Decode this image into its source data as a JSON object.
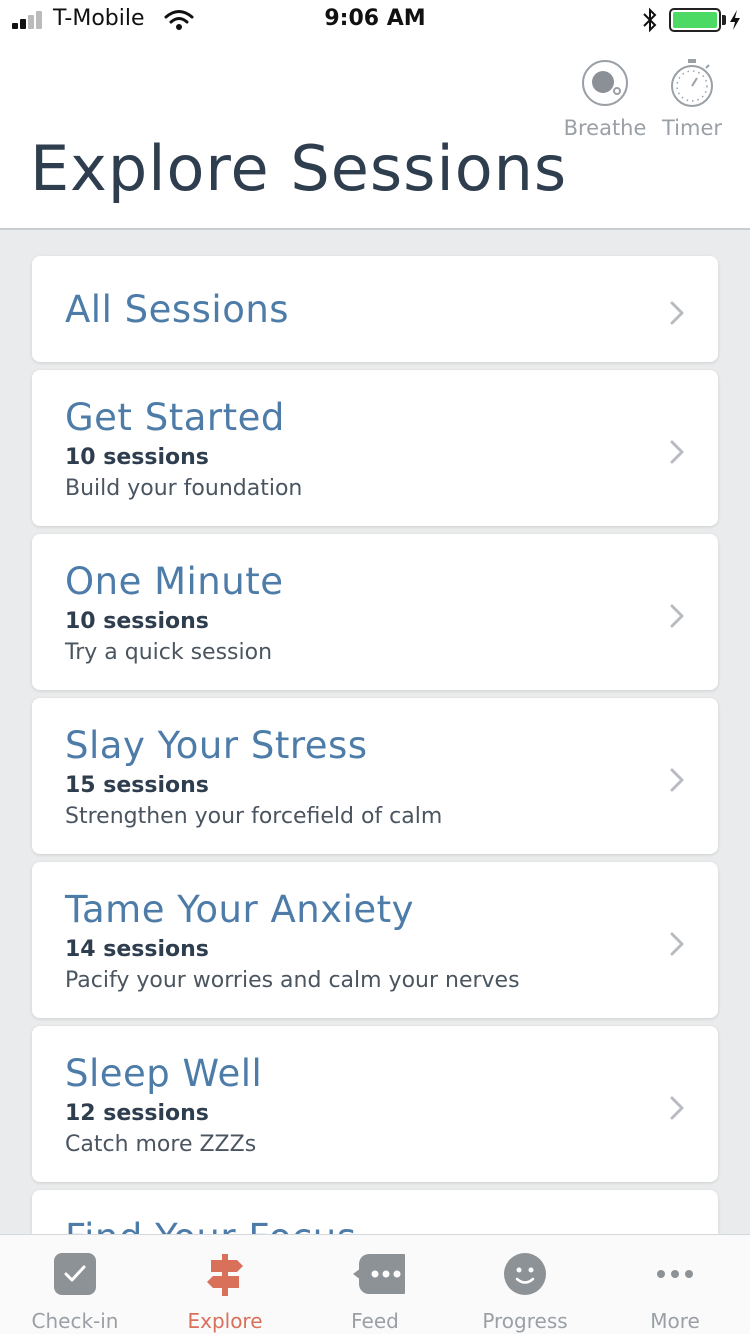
{
  "status_bar": {
    "carrier": "T-Mobile",
    "time": "9:06 AM",
    "icons": [
      "signal-icon",
      "wifi-icon",
      "bluetooth-icon",
      "battery-icon",
      "charging-icon"
    ]
  },
  "header": {
    "title": "Explore Sessions",
    "tools": [
      {
        "label": "Breathe",
        "icon": "breathe-icon"
      },
      {
        "label": "Timer",
        "icon": "stopwatch-icon"
      }
    ]
  },
  "sessions": [
    {
      "title": "All Sessions"
    },
    {
      "title": "Get Started",
      "count": "10 sessions",
      "description": "Build your foundation"
    },
    {
      "title": "One Minute",
      "count": "10 sessions",
      "description": "Try a quick session"
    },
    {
      "title": "Slay Your Stress",
      "count": "15 sessions",
      "description": "Strengthen your forcefield of calm"
    },
    {
      "title": "Tame Your Anxiety",
      "count": "14 sessions",
      "description": "Pacify your worries and calm your nerves"
    },
    {
      "title": "Sleep Well",
      "count": "12 sessions",
      "description": "Catch more ZZZs"
    },
    {
      "title": "Find Your Focus"
    }
  ],
  "tabbar": {
    "tabs": [
      {
        "label": "Check-in",
        "icon": "checkmark-icon"
      },
      {
        "label": "Explore",
        "icon": "signpost-icon",
        "active": true
      },
      {
        "label": "Feed",
        "icon": "chat-bubble-icon"
      },
      {
        "label": "Progress",
        "icon": "smiley-icon"
      },
      {
        "label": "More",
        "icon": "more-dots-icon"
      }
    ]
  },
  "colors": {
    "accent": "#d9705a",
    "session_title": "#4d7ca8",
    "page_title": "#2f3e4e",
    "inactive_gray": "#9aa0a6",
    "background": "#e9ebec"
  }
}
